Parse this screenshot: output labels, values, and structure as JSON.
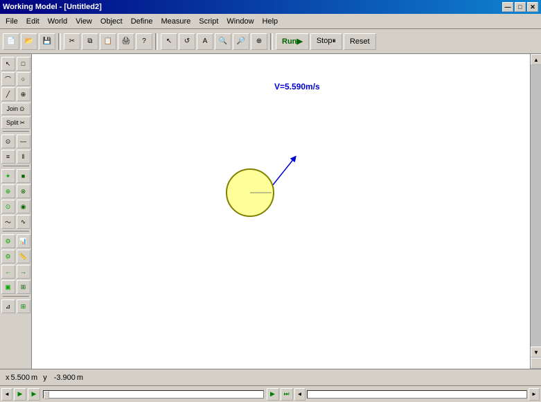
{
  "titleBar": {
    "title": "Working Model - [Untitled2]",
    "buttons": {
      "minimize": "—",
      "maximize": "□",
      "close": "✕"
    }
  },
  "menuBar": {
    "items": [
      "File",
      "Edit",
      "World",
      "View",
      "Object",
      "Define",
      "Measure",
      "Script",
      "Window",
      "Help"
    ]
  },
  "toolbar": {
    "runLabel": "Run▶",
    "stopLabel": "Stop⏸",
    "resetLabel": "Reset"
  },
  "simulation": {
    "velocityLabel": "V=5.590m/s"
  },
  "statusBar": {
    "xLabel": "x",
    "xValue": "5.500",
    "xUnit": "m",
    "yLabel": "y",
    "yValue": "-3.900",
    "yUnit": "m"
  },
  "leftToolbar": {
    "joinLabel": "Join",
    "splitLabel": "Split"
  }
}
